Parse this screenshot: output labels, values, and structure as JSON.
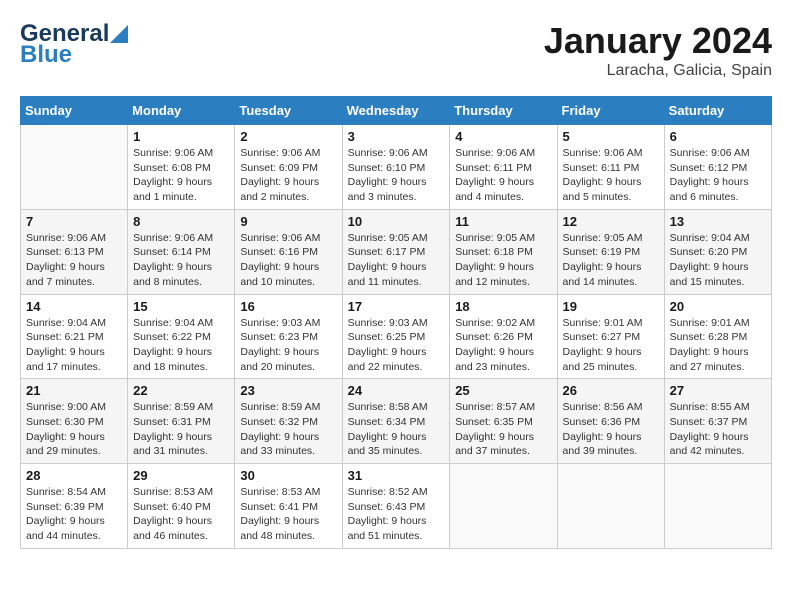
{
  "header": {
    "logo_general": "General",
    "logo_blue": "Blue",
    "title": "January 2024",
    "subtitle": "Laracha, Galicia, Spain"
  },
  "calendar": {
    "days_of_week": [
      "Sunday",
      "Monday",
      "Tuesday",
      "Wednesday",
      "Thursday",
      "Friday",
      "Saturday"
    ],
    "weeks": [
      [
        {
          "day": "",
          "info": ""
        },
        {
          "day": "1",
          "info": "Sunrise: 9:06 AM\nSunset: 6:08 PM\nDaylight: 9 hours\nand 1 minute."
        },
        {
          "day": "2",
          "info": "Sunrise: 9:06 AM\nSunset: 6:09 PM\nDaylight: 9 hours\nand 2 minutes."
        },
        {
          "day": "3",
          "info": "Sunrise: 9:06 AM\nSunset: 6:10 PM\nDaylight: 9 hours\nand 3 minutes."
        },
        {
          "day": "4",
          "info": "Sunrise: 9:06 AM\nSunset: 6:11 PM\nDaylight: 9 hours\nand 4 minutes."
        },
        {
          "day": "5",
          "info": "Sunrise: 9:06 AM\nSunset: 6:11 PM\nDaylight: 9 hours\nand 5 minutes."
        },
        {
          "day": "6",
          "info": "Sunrise: 9:06 AM\nSunset: 6:12 PM\nDaylight: 9 hours\nand 6 minutes."
        }
      ],
      [
        {
          "day": "7",
          "info": "Sunrise: 9:06 AM\nSunset: 6:13 PM\nDaylight: 9 hours\nand 7 minutes."
        },
        {
          "day": "8",
          "info": "Sunrise: 9:06 AM\nSunset: 6:14 PM\nDaylight: 9 hours\nand 8 minutes."
        },
        {
          "day": "9",
          "info": "Sunrise: 9:06 AM\nSunset: 6:16 PM\nDaylight: 9 hours\nand 10 minutes."
        },
        {
          "day": "10",
          "info": "Sunrise: 9:05 AM\nSunset: 6:17 PM\nDaylight: 9 hours\nand 11 minutes."
        },
        {
          "day": "11",
          "info": "Sunrise: 9:05 AM\nSunset: 6:18 PM\nDaylight: 9 hours\nand 12 minutes."
        },
        {
          "day": "12",
          "info": "Sunrise: 9:05 AM\nSunset: 6:19 PM\nDaylight: 9 hours\nand 14 minutes."
        },
        {
          "day": "13",
          "info": "Sunrise: 9:04 AM\nSunset: 6:20 PM\nDaylight: 9 hours\nand 15 minutes."
        }
      ],
      [
        {
          "day": "14",
          "info": "Sunrise: 9:04 AM\nSunset: 6:21 PM\nDaylight: 9 hours\nand 17 minutes."
        },
        {
          "day": "15",
          "info": "Sunrise: 9:04 AM\nSunset: 6:22 PM\nDaylight: 9 hours\nand 18 minutes."
        },
        {
          "day": "16",
          "info": "Sunrise: 9:03 AM\nSunset: 6:23 PM\nDaylight: 9 hours\nand 20 minutes."
        },
        {
          "day": "17",
          "info": "Sunrise: 9:03 AM\nSunset: 6:25 PM\nDaylight: 9 hours\nand 22 minutes."
        },
        {
          "day": "18",
          "info": "Sunrise: 9:02 AM\nSunset: 6:26 PM\nDaylight: 9 hours\nand 23 minutes."
        },
        {
          "day": "19",
          "info": "Sunrise: 9:01 AM\nSunset: 6:27 PM\nDaylight: 9 hours\nand 25 minutes."
        },
        {
          "day": "20",
          "info": "Sunrise: 9:01 AM\nSunset: 6:28 PM\nDaylight: 9 hours\nand 27 minutes."
        }
      ],
      [
        {
          "day": "21",
          "info": "Sunrise: 9:00 AM\nSunset: 6:30 PM\nDaylight: 9 hours\nand 29 minutes."
        },
        {
          "day": "22",
          "info": "Sunrise: 8:59 AM\nSunset: 6:31 PM\nDaylight: 9 hours\nand 31 minutes."
        },
        {
          "day": "23",
          "info": "Sunrise: 8:59 AM\nSunset: 6:32 PM\nDaylight: 9 hours\nand 33 minutes."
        },
        {
          "day": "24",
          "info": "Sunrise: 8:58 AM\nSunset: 6:34 PM\nDaylight: 9 hours\nand 35 minutes."
        },
        {
          "day": "25",
          "info": "Sunrise: 8:57 AM\nSunset: 6:35 PM\nDaylight: 9 hours\nand 37 minutes."
        },
        {
          "day": "26",
          "info": "Sunrise: 8:56 AM\nSunset: 6:36 PM\nDaylight: 9 hours\nand 39 minutes."
        },
        {
          "day": "27",
          "info": "Sunrise: 8:55 AM\nSunset: 6:37 PM\nDaylight: 9 hours\nand 42 minutes."
        }
      ],
      [
        {
          "day": "28",
          "info": "Sunrise: 8:54 AM\nSunset: 6:39 PM\nDaylight: 9 hours\nand 44 minutes."
        },
        {
          "day": "29",
          "info": "Sunrise: 8:53 AM\nSunset: 6:40 PM\nDaylight: 9 hours\nand 46 minutes."
        },
        {
          "day": "30",
          "info": "Sunrise: 8:53 AM\nSunset: 6:41 PM\nDaylight: 9 hours\nand 48 minutes."
        },
        {
          "day": "31",
          "info": "Sunrise: 8:52 AM\nSunset: 6:43 PM\nDaylight: 9 hours\nand 51 minutes."
        },
        {
          "day": "",
          "info": ""
        },
        {
          "day": "",
          "info": ""
        },
        {
          "day": "",
          "info": ""
        }
      ]
    ]
  }
}
